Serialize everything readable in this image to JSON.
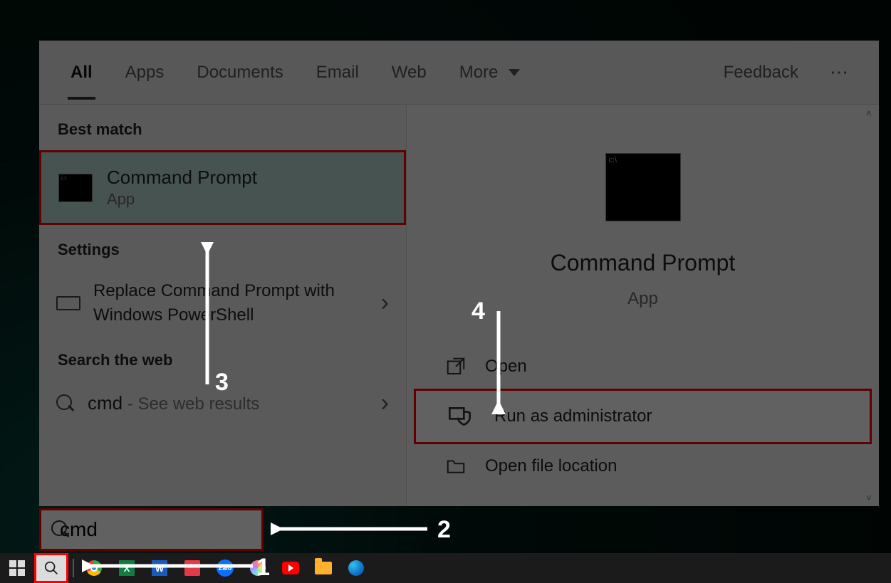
{
  "tabs": {
    "all": "All",
    "apps": "Apps",
    "documents": "Documents",
    "email": "Email",
    "web": "Web",
    "more": "More",
    "feedback": "Feedback"
  },
  "sections": {
    "best_match": "Best match",
    "settings": "Settings",
    "search_web": "Search the web"
  },
  "best_match": {
    "title": "Command Prompt",
    "subtitle": "App"
  },
  "settings_item": {
    "title": "Replace Command Prompt with Windows PowerShell"
  },
  "web_item": {
    "query": "cmd",
    "suffix": " - See web results"
  },
  "preview": {
    "title": "Command Prompt",
    "subtitle": "App"
  },
  "actions": {
    "open": "Open",
    "run_admin": "Run as administrator",
    "open_loc": "Open file location"
  },
  "search_input": {
    "value": "cmd"
  },
  "annotations": {
    "n1": "1",
    "n2": "2",
    "n3": "3",
    "n4": "4"
  }
}
